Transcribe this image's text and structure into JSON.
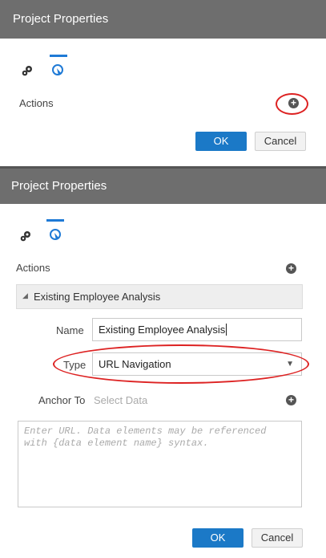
{
  "panel1": {
    "title": "Project Properties",
    "actions_label": "Actions",
    "ok_label": "OK",
    "cancel_label": "Cancel"
  },
  "panel2": {
    "title": "Project Properties",
    "actions_label": "Actions",
    "action_section_title": "Existing Employee Analysis",
    "name_label": "Name",
    "name_value": "Existing Employee Analysis",
    "type_label": "Type",
    "type_value": "URL Navigation",
    "anchor_label": "Anchor To",
    "anchor_placeholder": "Select Data",
    "url_placeholder": "Enter URL. Data elements may be referenced with {data element name} syntax.",
    "ok_label": "OK",
    "cancel_label": "Cancel"
  },
  "colors": {
    "titlebar": "#6e6e6e",
    "accent": "#1b79c7",
    "highlight": "#dd2222"
  },
  "icons": [
    "gear-icon",
    "cursor-icon",
    "add-icon",
    "dropdown-arrow-icon"
  ]
}
